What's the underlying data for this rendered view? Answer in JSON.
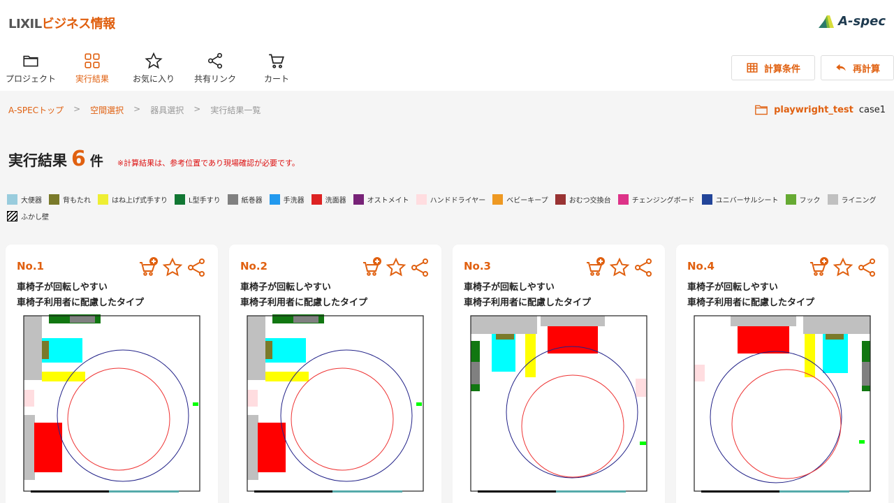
{
  "brand": {
    "prefix": "LIXIL",
    "suffix": "ビジネス情報"
  },
  "app_logo": {
    "text": "A-spec",
    "icon": "aspec-logo-icon"
  },
  "nav": [
    {
      "label": "プロジェクト",
      "icon": "folder-icon",
      "active": false
    },
    {
      "label": "実行結果",
      "icon": "grid-icon",
      "active": true
    },
    {
      "label": "お気に入り",
      "icon": "star-icon",
      "active": false
    },
    {
      "label": "共有リンク",
      "icon": "share-icon",
      "active": false
    },
    {
      "label": "カート",
      "icon": "cart-icon",
      "active": false
    }
  ],
  "actions": {
    "conditions_label": "計算条件",
    "recalc_label": "再計算"
  },
  "breadcrumb": {
    "items": [
      "A-SPECトップ",
      "空間選択",
      "器具選択",
      "実行結果一覧"
    ],
    "separator": ">"
  },
  "project": {
    "name": "playwright_test",
    "case": "case1"
  },
  "results": {
    "title": "実行結果",
    "count": "6",
    "unit": "件",
    "note": "※計算結果は、参考位置であり現場確認が必要です。"
  },
  "legend": [
    {
      "label": "大便器",
      "color": "#99ccdd"
    },
    {
      "label": "背もたれ",
      "color": "#7a7a2a"
    },
    {
      "label": "はね上げ式手すり",
      "color": "#eeee33"
    },
    {
      "label": "L型手すり",
      "color": "#117733"
    },
    {
      "label": "紙巻器",
      "color": "#808080"
    },
    {
      "label": "手洗器",
      "color": "#2299ee"
    },
    {
      "label": "洗面器",
      "color": "#dd2222"
    },
    {
      "label": "オストメイト",
      "color": "#772277"
    },
    {
      "label": "ハンドドライヤー",
      "color": "#ffdde0"
    },
    {
      "label": "ベビーキープ",
      "color": "#ee9922"
    },
    {
      "label": "おむつ交換台",
      "color": "#993333"
    },
    {
      "label": "チェンジングボード",
      "color": "#dd3388"
    },
    {
      "label": "ユニバーサルシート",
      "color": "#224499"
    },
    {
      "label": "フック",
      "color": "#66aa33"
    },
    {
      "label": "ライニング",
      "color": "#c0c0c0"
    },
    {
      "label": "ふかし壁",
      "color": "hatch"
    }
  ],
  "cards": [
    {
      "no": "No.1",
      "line1": "車椅子が回転しやすい",
      "line2": "車椅子利用者に配慮したタイプ"
    },
    {
      "no": "No.2",
      "line1": "車椅子が回転しやすい",
      "line2": "車椅子利用者に配慮したタイプ"
    },
    {
      "no": "No.3",
      "line1": "車椅子が回転しやすい",
      "line2": "車椅子利用者に配慮したタイプ"
    },
    {
      "no": "No.4",
      "line1": "車椅子が回転しやすい",
      "line2": "車椅子利用者に配慮したタイプ"
    }
  ],
  "colors": {
    "accent": "#e06010",
    "note": "#dd1111"
  }
}
